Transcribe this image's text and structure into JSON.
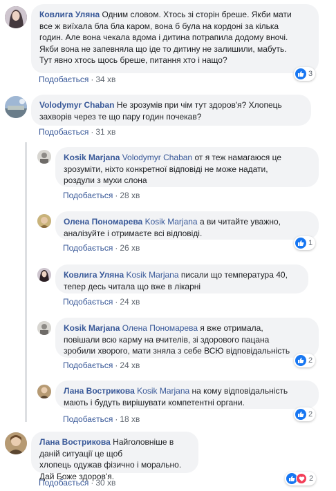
{
  "common": {
    "reply": "Подобається",
    "dot": "·"
  },
  "comments": [
    {
      "author": "Ковлига Уляна",
      "mention": "",
      "text_lines": [
        "Одним словом. Хтось зі сторін бреше. Якби мати",
        "все ж виїхала бла бла каром, вона б була на кордоні за кілька",
        "годин. Але вона чекала вдома і дитина потрапила додому вночі.",
        "Якби вона не запевняла що іде то дитину не залишили, мабуть.",
        "Тут явно хтось щось бреше, питання хто і нащо?"
      ],
      "time": "34 хв",
      "reactions": "3"
    },
    {
      "author": "Volodymyr Chaban",
      "mention": "",
      "text_lines": [
        "Не зрозумів при чім тут здоров'я? Хлопець",
        "захворів через те що пару годин почекав?"
      ],
      "time": "31 хв",
      "reactions": ""
    },
    {
      "author": "Kosik Marjana",
      "mention": "Volodymyr Chaban",
      "text_lines": [
        "от я теж намагаюся це",
        "зрозуміти, ніхто конкретної відповіді не може надати,",
        "роздули з мухи слона"
      ],
      "time": "28 хв",
      "reactions": ""
    },
    {
      "author": "Олена Пономарева",
      "mention": "Kosik Marjana",
      "text_lines": [
        "а ви читайте уважно,",
        "аналізуйте і отримаєте всі відповіді."
      ],
      "time": "26 хв",
      "reactions": "1"
    },
    {
      "author": "Ковлига Уляна",
      "mention": "Kosik Marjana",
      "text_lines": [
        "писали що температура 40,",
        "тепер десь читала що вже в лікарні"
      ],
      "time": "24 хв",
      "reactions": ""
    },
    {
      "author": "Kosik Marjana",
      "mention": "Олена Пономарева",
      "text_lines": [
        "я вже отримала,",
        "повішали всю карму на вчителів, зі здорового пацана",
        "зробили хворого, мати зняла з себе ВСЮ відповідальність"
      ],
      "time": "24 хв",
      "reactions": "2"
    },
    {
      "author": "Лана Вострикова",
      "mention": "Kosik Marjana",
      "text_lines": [
        "на кому відповідальність",
        "мають і будуть вирішувати компетентні органи."
      ],
      "time": "18 хв",
      "reactions": "2"
    },
    {
      "author": "Лана Вострикова",
      "mention": "",
      "text_lines": [
        "Найголовніше в даній ситуації це щоб",
        "хлопець одужав фізично і морально.",
        "Дай Боже здоров'я."
      ],
      "time": "30 хв",
      "reactions": "2"
    }
  ],
  "colors": {
    "author": "#385898",
    "bubble": "#f2f3f5",
    "like": "#1877f2",
    "love": "#f33e58"
  }
}
